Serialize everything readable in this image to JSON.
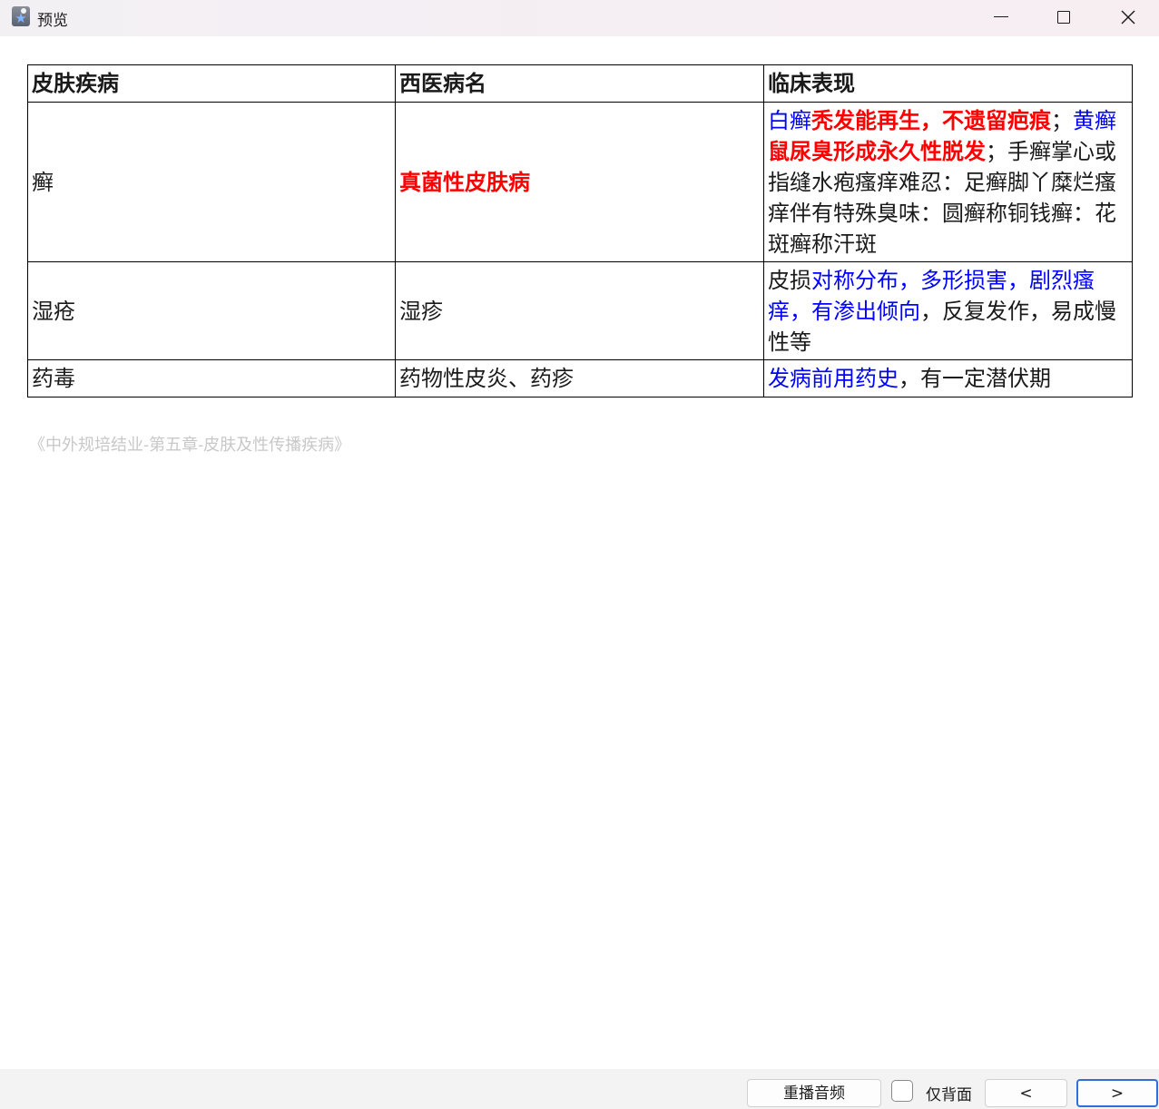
{
  "window": {
    "title": "预览",
    "icon": "app-star-icon",
    "controls": {
      "minimize": "minimize-icon",
      "maximize": "maximize-icon",
      "close": "close-icon"
    }
  },
  "table": {
    "headers": [
      "皮肤疾病",
      "西医病名",
      "临床表现"
    ],
    "rows": [
      {
        "disease": "癣",
        "western_name": "真菌性皮肤病",
        "manifestation_segments": [
          {
            "text": "白癣",
            "style": "blue"
          },
          {
            "text": "秃发能再生，不遗留疤痕",
            "style": "red-bold"
          },
          {
            "text": "；",
            "style": "dark"
          },
          {
            "text": "黄癣",
            "style": "blue"
          },
          {
            "text": "鼠尿臭形成永久性脱发",
            "style": "red-bold"
          },
          {
            "text": "；手癣掌心或指缝水疱瘙痒难忍：足癣脚丫糜烂瘙痒伴有特殊臭味：圆癣称铜钱癣：花斑癣称汗斑",
            "style": "dark"
          }
        ]
      },
      {
        "disease": "湿疮",
        "western_name": "湿疹",
        "manifestation_segments": [
          {
            "text": "皮损",
            "style": "dark"
          },
          {
            "text": "对称分布，多形损害，剧烈瘙痒，有渗出倾向",
            "style": "blue"
          },
          {
            "text": "，反复发作，易成慢性等",
            "style": "dark"
          }
        ]
      },
      {
        "disease": "药毒",
        "western_name": "药物性皮炎、药疹",
        "manifestation_segments": [
          {
            "text": "发病前用药史",
            "style": "blue"
          },
          {
            "text": "，有一定潜伏期",
            "style": "dark"
          }
        ]
      }
    ]
  },
  "source_note": "《中外规培结业-第五章-皮肤及性传播疾病》",
  "footer": {
    "replay_label": "重播音频",
    "back_only_label": "仅背面",
    "back_only_checked": false,
    "prev_label": "<",
    "next_label": ">"
  },
  "colors": {
    "emphasis_red": "#ff0000",
    "emphasis_blue": "#0000ff",
    "accent_focus": "#2f6fd6"
  }
}
